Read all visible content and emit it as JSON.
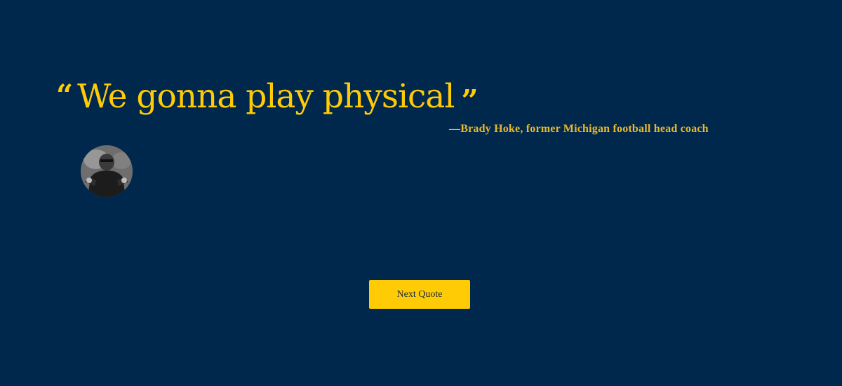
{
  "quote": {
    "open_mark": "“",
    "text": "We gonna play physical",
    "close_mark": "”",
    "attribution": "—Brady Hoke, former Michigan football head coach"
  },
  "avatar": {
    "icon": "coach-photo"
  },
  "button": {
    "next_label": "Next Quote"
  },
  "colors": {
    "background": "#00274c",
    "accent": "#ffcb05",
    "attribution": "#e6b82a"
  }
}
